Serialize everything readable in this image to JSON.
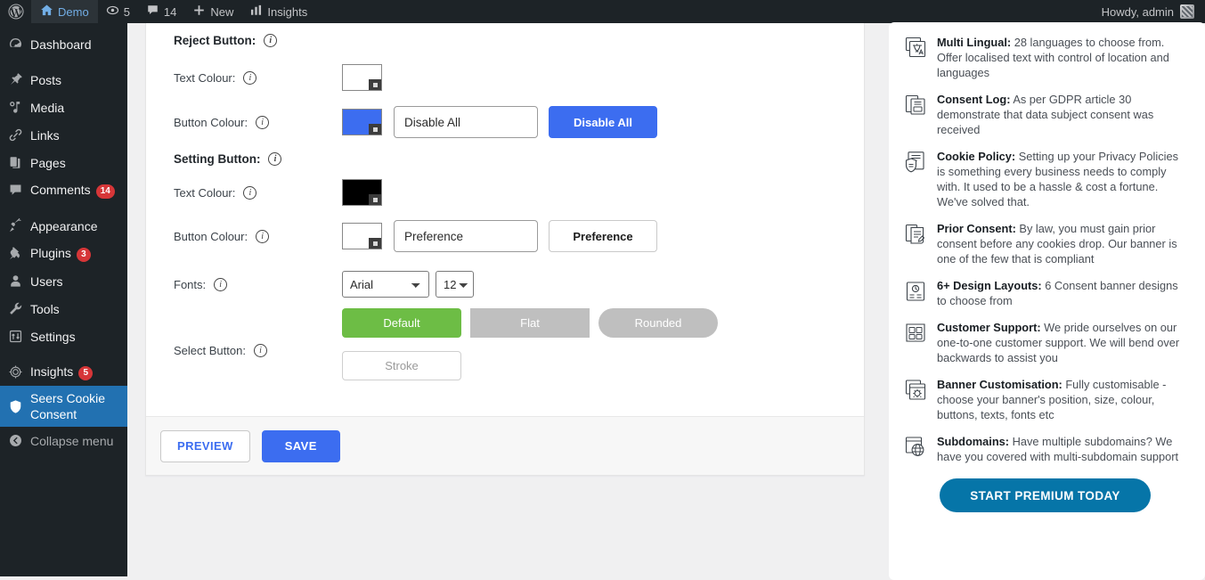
{
  "adminbar": {
    "logo_icon": "wordpress-logo-icon",
    "site_name": "Demo",
    "site_icon": "home-icon",
    "updates_icon": "updates-icon",
    "updates_count": "5",
    "comments_icon": "comment-bubble-icon",
    "comments_count": "14",
    "new_icon": "plus-icon",
    "new_label": "New",
    "insights_icon": "bar-chart-icon",
    "insights_label": "Insights",
    "howdy": "Howdy, admin",
    "avatar_icon": "avatar-icon"
  },
  "sidebar": {
    "items": [
      {
        "label": "Dashboard",
        "icon": "dashboard-icon",
        "badge": ""
      },
      {
        "label": "Posts",
        "icon": "pin-icon",
        "badge": ""
      },
      {
        "label": "Media",
        "icon": "media-icon",
        "badge": ""
      },
      {
        "label": "Links",
        "icon": "link-icon",
        "badge": ""
      },
      {
        "label": "Pages",
        "icon": "pages-icon",
        "badge": ""
      },
      {
        "label": "Comments",
        "icon": "comment-bubble-icon",
        "badge": "14"
      },
      {
        "label": "Appearance",
        "icon": "brush-icon",
        "badge": ""
      },
      {
        "label": "Plugins",
        "icon": "plug-icon",
        "badge": "3"
      },
      {
        "label": "Users",
        "icon": "user-icon",
        "badge": ""
      },
      {
        "label": "Tools",
        "icon": "wrench-icon",
        "badge": ""
      },
      {
        "label": "Settings",
        "icon": "settings-sliders-icon",
        "badge": ""
      },
      {
        "label": "Insights",
        "icon": "insights-icon",
        "badge": "5"
      },
      {
        "label": "Seers Cookie Consent",
        "icon": "shield-icon",
        "badge": ""
      },
      {
        "label": "Collapse menu",
        "icon": "collapse-arrow-icon",
        "badge": ""
      }
    ]
  },
  "form": {
    "reject_section_label": "Reject Button:",
    "reject_text_colour_label": "Text Colour:",
    "reject_text_colour_value": "#ffffff",
    "reject_button_colour_label": "Button Colour:",
    "reject_button_colour_value": "#3c6df0",
    "reject_input_value": "Disable All",
    "reject_preview_label": "Disable All",
    "setting_section_label": "Setting Button:",
    "setting_text_colour_label": "Text Colour:",
    "setting_text_colour_value": "#000000",
    "setting_button_colour_label": "Button Colour:",
    "setting_button_colour_value": "#ffffff",
    "setting_input_value": "Preference",
    "setting_preview_label": "Preference",
    "fonts_label": "Fonts:",
    "font_family_value": "Arial",
    "font_family_options": [
      "Arial"
    ],
    "font_size_value": "12",
    "font_size_options": [
      "12"
    ],
    "select_button_label": "Select Button:",
    "style_buttons": [
      {
        "label": "Default",
        "style": "default",
        "selected": true
      },
      {
        "label": "Flat",
        "style": "flat",
        "selected": false
      },
      {
        "label": "Rounded",
        "style": "rounded",
        "selected": false
      },
      {
        "label": "Stroke",
        "style": "stroke",
        "selected": false
      }
    ],
    "info_icon": "info-icon"
  },
  "footer": {
    "preview_label": "PREVIEW",
    "save_label": "SAVE"
  },
  "promo": {
    "features": [
      {
        "icon": "translate-icon",
        "title": "Multi Lingual:",
        "body": " 28 languages to choose from. Offer localised text with control of location and languages"
      },
      {
        "icon": "log-document-icon",
        "title": "Consent Log:",
        "body": " As per GDPR article 30 demonstrate that data subject consent was received"
      },
      {
        "icon": "cookie-policy-icon",
        "title": "Cookie Policy:",
        "body": " Setting up your Privacy Policies is something every business needs to comply with. It used to be a hassle & cost a fortune. We've solved that."
      },
      {
        "icon": "consent-document-icon",
        "title": "Prior Consent:",
        "body": " By law, you must gain prior consent before any cookies drop. Our banner is one of the few that is compliant"
      },
      {
        "icon": "layout-icon",
        "title": "6+ Design Layouts:",
        "body": " 6 Consent banner designs to choose from"
      },
      {
        "icon": "support-icon",
        "title": "Customer Support:",
        "body": " We pride ourselves on our one-to-one customer support. We will bend over backwards to assist you"
      },
      {
        "icon": "gear-window-icon",
        "title": "Banner Customisation:",
        "body": " Fully customisable - choose your banner's position, size, colour, buttons, texts, fonts etc"
      },
      {
        "icon": "globe-window-icon",
        "title": "Subdomains:",
        "body": " Have multiple subdomains? We have you covered with multi-subdomain support"
      }
    ],
    "cta_label": "START PREMIUM TODAY"
  },
  "colors": {
    "admin_dark": "#1d2327",
    "accent_blue": "#3c6df0",
    "current_menu_blue": "#2271b1",
    "green": "#6dbd45",
    "cta_blue": "#0675a8",
    "badge_red": "#d63638"
  }
}
